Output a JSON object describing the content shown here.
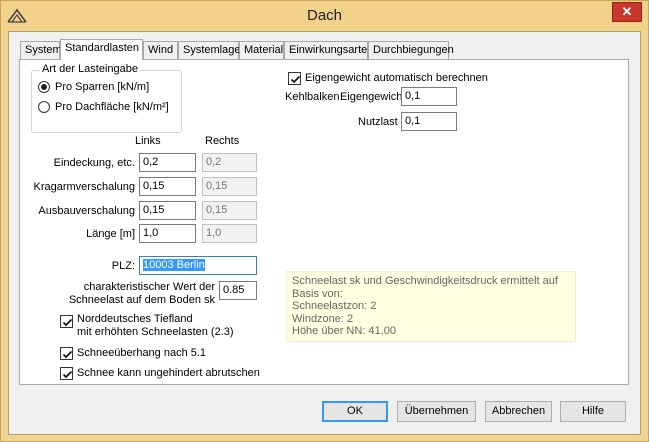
{
  "window": {
    "title": "Dach",
    "close_glyph": "✕",
    "app_icon": "roof-logo-icon"
  },
  "tabs": [
    {
      "label": "System"
    },
    {
      "label": "Standardlasten"
    },
    {
      "label": "Wind"
    },
    {
      "label": "Systemlager"
    },
    {
      "label": "Material"
    },
    {
      "label": "Einwirkungsarten"
    },
    {
      "label": "Durchbiegungen"
    }
  ],
  "active_tab": "Standardlasten",
  "load_input": {
    "group_label": "Art der Lasteingabe",
    "options": [
      {
        "label": "Pro Sparren [kN/m]",
        "selected": true
      },
      {
        "label": "Pro Dachfläche [kN/m²]",
        "selected": false
      }
    ]
  },
  "columns": {
    "left": "Links",
    "right": "Rechts"
  },
  "rows": [
    {
      "label": "Eindeckung, etc.",
      "left": "0,2",
      "right": "0,2"
    },
    {
      "label": "Kragarmverschalung",
      "left": "0,15",
      "right": "0,15"
    },
    {
      "label": "Ausbauverschalung",
      "left": "0,15",
      "right": "0,15"
    },
    {
      "label": "Länge [m]",
      "left": "1,0",
      "right": "1,0"
    }
  ],
  "self_weight": {
    "label": "Eigengewicht automatisch berechnen",
    "checked": true
  },
  "collar_beam": {
    "label": "Kehlbalken",
    "weight_label": "Eigengewicht",
    "weight_value": "0,1",
    "live_load_label": "Nutzlast",
    "live_load_value": "0,1"
  },
  "plz": {
    "label": "PLZ:",
    "value": "10003 Berlin"
  },
  "snow_value": {
    "label_line1": "charakteristischer Wert der",
    "label_line2": "Schneelast auf dem Boden sk",
    "value": "0.85"
  },
  "checks": [
    {
      "line1": "Norddeutsches Tiefland",
      "line2": "mit erhöhten Schneelasten (2.3)",
      "checked": true
    },
    {
      "line1": "Schneeüberhang nach 5.1",
      "line2": "",
      "checked": true
    },
    {
      "line1": "Schnee kann ungehindert abrutschen",
      "line2": "",
      "checked": true
    }
  ],
  "info": [
    "Schneelast sk und Geschwindigkeitsdruck ermittelt auf Basis von:",
    "Schneelastzon: 2",
    "Windzone: 2",
    "Höhe über NN: 41,00"
  ],
  "buttons": {
    "ok": "OK",
    "apply": "Übernehmen",
    "cancel": "Abbrechen",
    "help": "Hilfe"
  }
}
